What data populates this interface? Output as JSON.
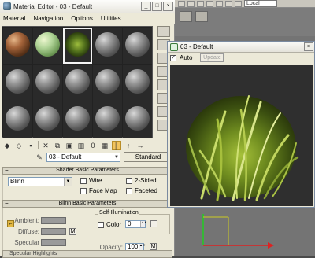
{
  "material_editor": {
    "title": "Material Editor - 03 - Default",
    "window_buttons": [
      "_",
      "□",
      "×"
    ],
    "menu": [
      "Material",
      "Navigation",
      "Options",
      "Utilities"
    ],
    "slots": [
      {
        "type": "brown"
      },
      {
        "type": "green"
      },
      {
        "type": "grass",
        "active": true
      },
      {
        "type": "gray"
      },
      {
        "type": "gray"
      },
      {
        "type": "gray"
      },
      {
        "type": "gray"
      },
      {
        "type": "gray"
      },
      {
        "type": "gray"
      },
      {
        "type": "gray"
      },
      {
        "type": "gray"
      },
      {
        "type": "gray"
      },
      {
        "type": "gray"
      },
      {
        "type": "gray"
      },
      {
        "type": "gray"
      }
    ],
    "material_name": "03 - Default",
    "material_type_button": "Standard",
    "shader_rollout": {
      "title": "Shader Basic Parameters",
      "shader": "Blinn",
      "options": [
        "Wire",
        "2-Sided",
        "Face Map",
        "Faceted"
      ]
    },
    "blinn_rollout": {
      "title": "Blinn Basic Parameters",
      "self_illumination_label": "Self-Illumination",
      "color_label": "Color",
      "color_value": "0",
      "ambient_label": "Ambient:",
      "diffuse_label": "Diffuse:",
      "specular_label": "Specular",
      "opacity_label": "Opacity:",
      "opacity_value": "100",
      "map_button": "M"
    },
    "specular_rollout_title": "Specular Highlights"
  },
  "preview": {
    "title": "03 - Default",
    "auto_label": "Auto",
    "auto_checked": true,
    "update_label": "Update"
  },
  "viewport": {
    "dropdown": "Local"
  }
}
